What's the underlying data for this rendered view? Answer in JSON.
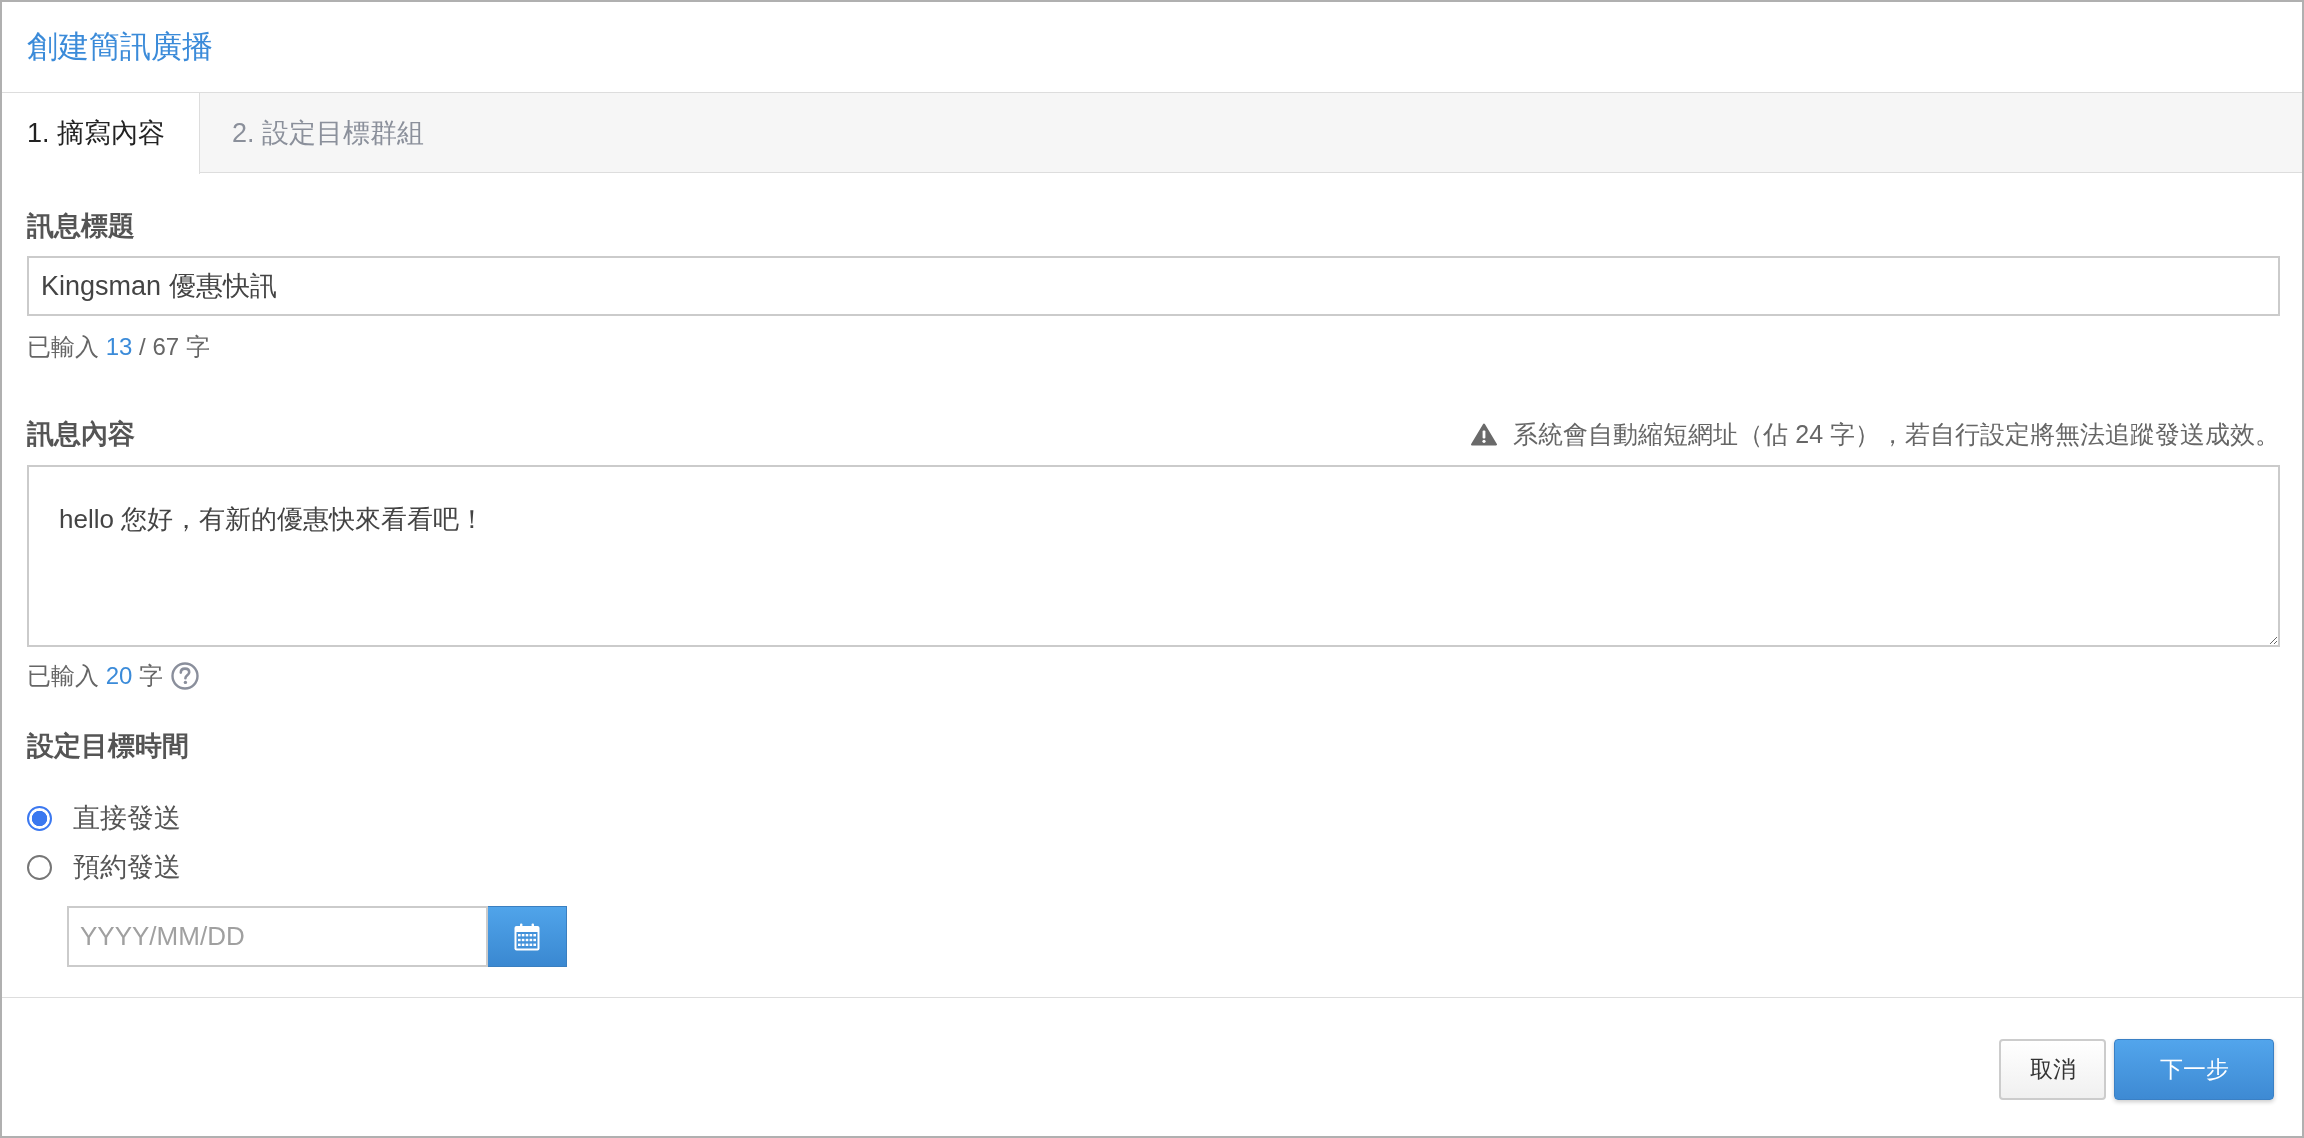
{
  "header": {
    "title": "創建簡訊廣播"
  },
  "tabs": [
    {
      "label": "1. 摘寫內容",
      "selected": true
    },
    {
      "label": "2. 設定目標群組",
      "selected": false
    }
  ],
  "message_title": {
    "label": "訊息標題",
    "value": "Kingsman 優惠快訊",
    "counter": {
      "prefix": "已輸入",
      "count": "13",
      "suffix": "/ 67 字"
    }
  },
  "message_content": {
    "label": "訊息內容",
    "notice": "系統會自動縮短網址（佔 24 字），若自行設定將無法追蹤發送成效。",
    "value": "hello 您好，有新的優惠快來看看吧！",
    "counter": {
      "prefix": "已輸入",
      "count": "20",
      "suffix": "字"
    }
  },
  "schedule": {
    "label": "設定目標時間",
    "options": [
      {
        "label": "直接發送",
        "selected": true
      },
      {
        "label": "預約發送",
        "selected": false
      }
    ],
    "date_field": {
      "placeholder": "YYYY/MM/DD"
    }
  },
  "buttons": [
    {
      "label": "取消",
      "kind": "secondary"
    },
    {
      "label": "下一步",
      "kind": "primary"
    }
  ]
}
